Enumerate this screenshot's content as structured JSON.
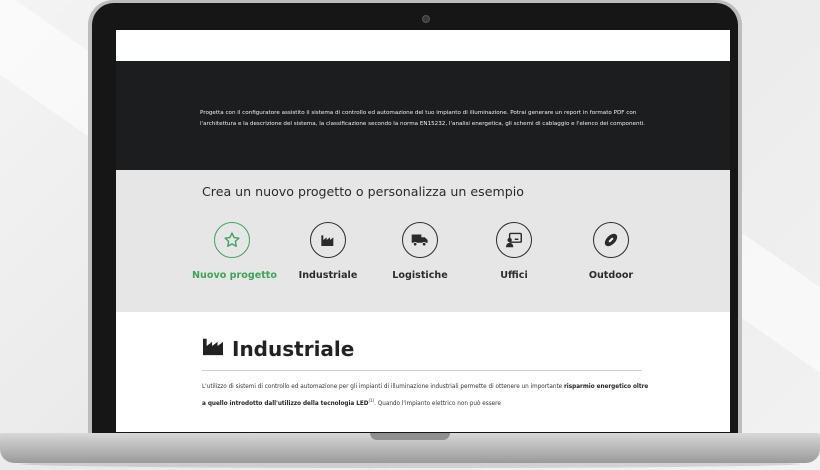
{
  "intro": {
    "text": "Progetta con il configuratore assistito il sistema di controllo ed automazione del tuo impianto di illuminazione. Potrai generare un report in formato PDF con l'architettura e la descrizione del sistema, la classificazione secondo la norma EN15232, l'analisi energetica, gli schemi di cablaggio e l'elenco dei componenti."
  },
  "chooser": {
    "heading": "Crea un nuovo progetto o personalizza un esempio",
    "options": [
      {
        "label": "Nuovo progetto",
        "icon": "star-icon",
        "active": true
      },
      {
        "label": "Industriale",
        "icon": "factory-icon",
        "active": false
      },
      {
        "label": "Logistiche",
        "icon": "truck-icon",
        "active": false
      },
      {
        "label": "Uffici",
        "icon": "presentation-icon",
        "active": false
      },
      {
        "label": "Outdoor",
        "icon": "football-icon",
        "active": false
      }
    ],
    "accent": "#3aa557"
  },
  "section": {
    "title": "Industriale",
    "icon": "factory-icon",
    "para_start": "L'utilizzo di sistemi di controllo ed automazione per gli impianti di illuminazione industriali permette di ottenere un importante ",
    "para_bold": "risparmio energetico oltre a quello introdotto dall'utilizzo della tecnologia LED",
    "para_sup": "(1)",
    "para_end": ". Quando l'impianto elettrico non può essere"
  }
}
